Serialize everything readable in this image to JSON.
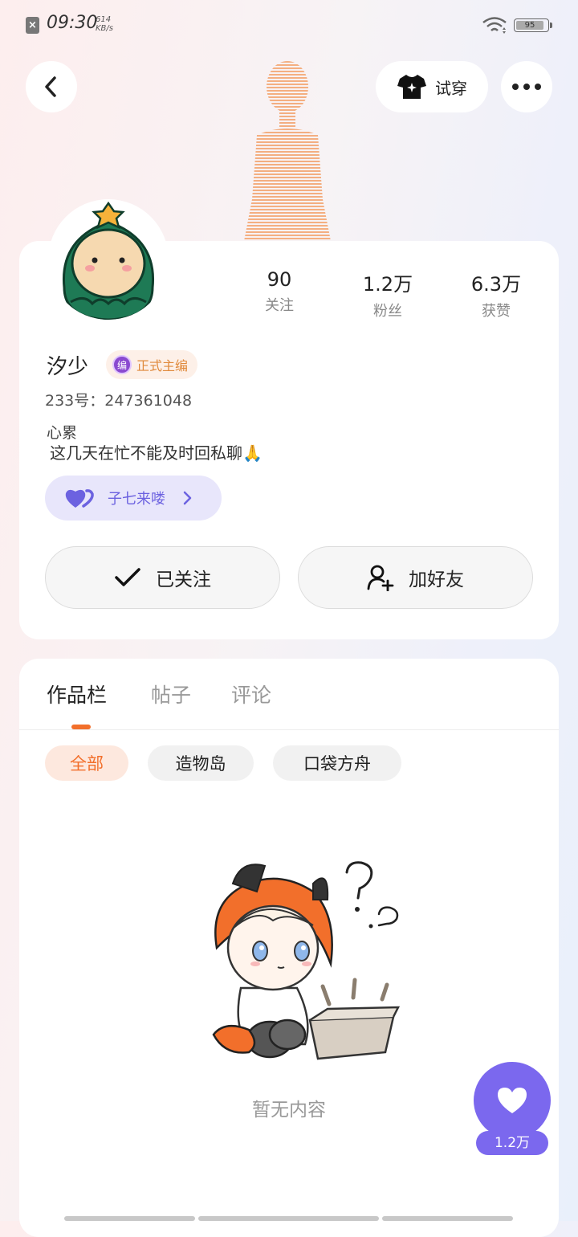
{
  "status_bar": {
    "time": "09:30",
    "speed_value": "614",
    "speed_unit": "KB/s",
    "battery": "95"
  },
  "header": {
    "tryon_label": "试穿"
  },
  "profile": {
    "stats": [
      {
        "value": "90",
        "label": "关注"
      },
      {
        "value": "1.2万",
        "label": "粉丝"
      },
      {
        "value": "6.3万",
        "label": "获赞"
      }
    ],
    "name": "汐少",
    "badge_icon_text": "编",
    "badge": "正式主编",
    "uid": "233号：247361048",
    "bio_line1": "心累",
    "bio_line2": "这几天在忙不能及时回私聊🙏",
    "fan_group": "子七来喽",
    "follow_button": "已关注",
    "add_friend_button": "加好友"
  },
  "works": {
    "tabs": [
      "作品栏",
      "帖子",
      "评论"
    ],
    "active_tab": 0,
    "filters": [
      "全部",
      "造物岛",
      "口袋方舟"
    ],
    "active_filter": 0,
    "empty_text": "暂无内容"
  },
  "fab": {
    "count": "1.2万"
  },
  "colors": {
    "accent_orange": "#f26f2b",
    "purple": "#7b68ee",
    "fan_pill_bg": "#e8e6fb"
  }
}
